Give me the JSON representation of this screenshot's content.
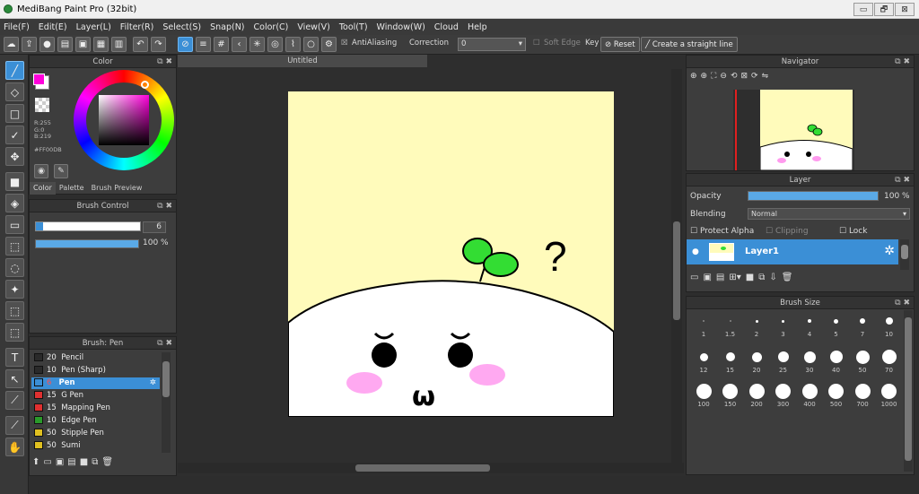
{
  "window": {
    "title": "MediBang Paint Pro (32bit)",
    "btn_min": "▭",
    "btn_max": "🗗",
    "btn_close": "⊠"
  },
  "menu": [
    "File(F)",
    "Edit(E)",
    "Layer(L)",
    "Filter(R)",
    "Select(S)",
    "Snap(N)",
    "Color(C)",
    "View(V)",
    "Tool(T)",
    "Window(W)",
    "Cloud",
    "Help"
  ],
  "toolbar": {
    "antialiasing": "AntiAliasing",
    "correction_label": "Correction",
    "correction_value": "0",
    "soft_edge": "Soft Edge",
    "key_label": "Key",
    "reset": "Reset",
    "straight_line": "Create a straight line"
  },
  "color_panel": {
    "title": "Color",
    "r": "R:255",
    "g": "G:0",
    "b": "B:219",
    "hex": "#FF00DB",
    "tabs": [
      "Color",
      "Palette",
      "Brush Preview"
    ],
    "primary": "#ff00db"
  },
  "brush_control": {
    "title": "Brush Control",
    "size": "6",
    "opacity": "100 %",
    "opacity_fraction": 1.0
  },
  "brush_panel": {
    "title": "Brush: Pen",
    "items": [
      {
        "size": "20",
        "name": "Pencil",
        "color": "#2a2a2a"
      },
      {
        "size": "10",
        "name": "Pen (Sharp)",
        "color": "#2a2a2a"
      },
      {
        "size": "6",
        "name": "Pen",
        "color": "#3b8fd6"
      },
      {
        "size": "15",
        "name": "G Pen",
        "color": "#e03030"
      },
      {
        "size": "15",
        "name": "Mapping Pen",
        "color": "#e03030"
      },
      {
        "size": "10",
        "name": "Edge Pen",
        "color": "#2a9a2a"
      },
      {
        "size": "50",
        "name": "Stipple Pen",
        "color": "#e0c020"
      },
      {
        "size": "50",
        "name": "Sumi",
        "color": "#e0c020"
      }
    ]
  },
  "canvas": {
    "tab": "Untitled",
    "question": "?",
    "mouth": "ω"
  },
  "navigator": {
    "title": "Navigator"
  },
  "layer_panel": {
    "title": "Layer",
    "opacity_label": "Opacity",
    "opacity_value": "100 %",
    "opacity_fraction": 1.0,
    "blending_label": "Blending",
    "blending_value": "Normal",
    "protect_alpha": "Protect Alpha",
    "clipping": "Clipping",
    "lock": "Lock",
    "layer_name": "Layer1"
  },
  "brush_size": {
    "title": "Brush Size",
    "row1": [
      "1",
      "1.5",
      "2",
      "3",
      "4",
      "5",
      "7",
      "10"
    ],
    "row2": [
      "12",
      "15",
      "20",
      "25",
      "30",
      "40",
      "50",
      "70"
    ],
    "row3": [
      "100",
      "150",
      "200",
      "300",
      "400",
      "500",
      "700",
      "1000"
    ]
  }
}
